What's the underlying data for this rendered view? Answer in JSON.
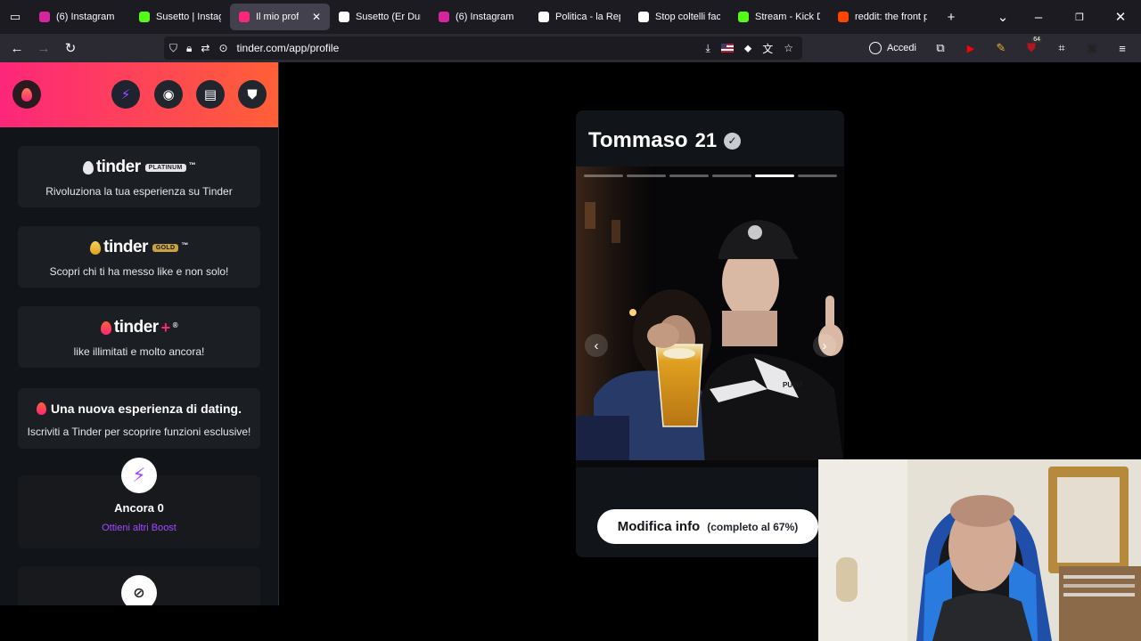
{
  "browser": {
    "tabs": [
      {
        "title": "(6) Instagram",
        "favicon_color": "#d6249f",
        "active": false
      },
      {
        "title": "Susetto | Instagra",
        "favicon_color": "#53fc18",
        "active": false
      },
      {
        "title": "Il mio profilo |",
        "favicon_color": "#fd267a",
        "active": true
      },
      {
        "title": "Susetto (Er Duro)",
        "favicon_color": "#ffffff",
        "active": false
      },
      {
        "title": "(6) Instagram",
        "favicon_color": "#d6249f",
        "active": false
      },
      {
        "title": "Politica - la Repub",
        "favicon_color": "#ffffff",
        "active": false
      },
      {
        "title": "Stop coltelli facili",
        "favicon_color": "#ffffff",
        "active": false
      },
      {
        "title": "Stream - Kick Das",
        "favicon_color": "#53fc18",
        "active": false
      },
      {
        "title": "reddit: the front p",
        "favicon_color": "#ff4500",
        "active": false
      }
    ],
    "url": "tinder.com/app/profile",
    "accedi_label": "Accedi",
    "extension_badge": "64"
  },
  "sidebar": {
    "platinum": {
      "brand": "tinder",
      "tag": "PLATINUM",
      "desc": "Rivoluziona la tua esperienza su Tinder"
    },
    "gold": {
      "brand": "tinder",
      "tag": "GOLD",
      "desc": "Scopri chi ti ha messo like e non solo!"
    },
    "plus": {
      "brand": "tinder",
      "desc": "like illimitati e molto ancora!"
    },
    "dating": {
      "title": "Una nuova esperienza di dating.",
      "desc": "Iscriviti a Tinder per scoprire funzioni esclusive!"
    },
    "boost": {
      "title": "Ancora 0",
      "link": "Ottieni altri Boost"
    }
  },
  "profile": {
    "name": "Tommaso",
    "age": "21",
    "photo_count": 6,
    "current_photo": 5,
    "edit_label": "Modifica info",
    "completion": "(completo al 67%)"
  },
  "colors": {
    "brand_gradient_start": "#fd267a",
    "brand_gradient_end": "#ff6036",
    "boost_purple": "#a04bff",
    "gold": "#e8b430"
  }
}
